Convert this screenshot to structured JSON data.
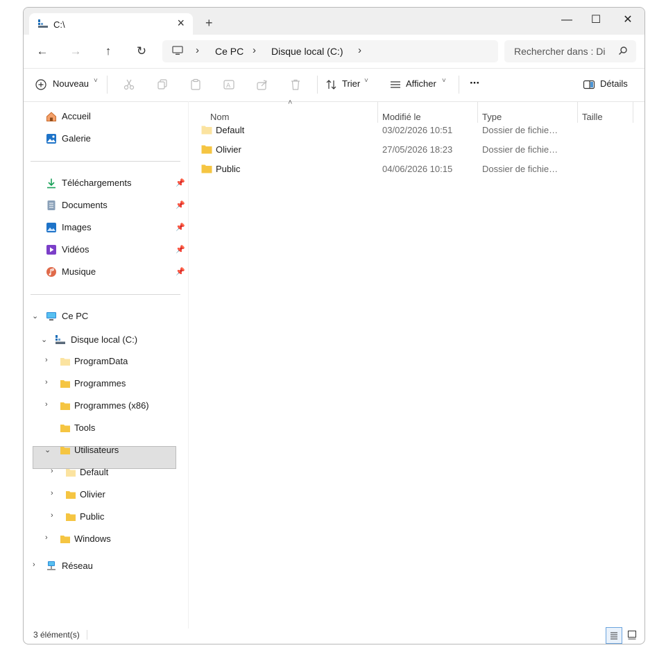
{
  "tab": {
    "title": "C:\\"
  },
  "window": {
    "minimize_glyph": "—",
    "maximize_glyph": "☐",
    "close_glyph": "✕"
  },
  "nav": {
    "back_glyph": "←",
    "forward_glyph": "→",
    "up_glyph": "↑",
    "refresh_glyph": "↻",
    "breadcrumbs": [
      "Ce PC",
      "Disque local (C:)"
    ],
    "chevron": "›",
    "search_placeholder": "Rechercher dans : Disque local (C:)"
  },
  "toolbar": {
    "new_label": "Nouveau",
    "sort_label": "Trier",
    "view_label": "Afficher",
    "more_glyph": "···",
    "details_label": "Détails",
    "dropdown_glyph": "˅"
  },
  "sidebar": {
    "quick": [
      {
        "label": "Accueil",
        "icon": "home-icon"
      },
      {
        "label": "Galerie",
        "icon": "gallery-icon"
      }
    ],
    "pinned": [
      {
        "label": "Téléchargements",
        "icon": "download-icon"
      },
      {
        "label": "Documents",
        "icon": "documents-icon"
      },
      {
        "label": "Images",
        "icon": "pictures-icon"
      },
      {
        "label": "Vidéos",
        "icon": "videos-icon"
      },
      {
        "label": "Musique",
        "icon": "music-icon"
      }
    ],
    "pin_glyph": "📌",
    "tree": {
      "this_pc": "Ce PC",
      "drive": "Disque local (C:)",
      "drive_children": [
        "ProgramData",
        "Programmes",
        "Programmes (x86)",
        "Tools",
        "Utilisateurs"
      ],
      "users_children": [
        "Default",
        "Olivier",
        "Public"
      ],
      "windows": "Windows",
      "network": "Réseau"
    }
  },
  "columns": {
    "name": "Nom",
    "modified": "Modifié le",
    "type": "Type",
    "size": "Taille"
  },
  "files": [
    {
      "name": "Default",
      "modified": "03/02/2026 10:51",
      "type": "Dossier de fichie…"
    },
    {
      "name": "Olivier",
      "modified": "27/05/2026 18:23",
      "type": "Dossier de fichie…"
    },
    {
      "name": "Public",
      "modified": "04/06/2026 10:15",
      "type": "Dossier de fichie…"
    }
  ],
  "status": {
    "count": "3 élément(s)"
  },
  "colors": {
    "folder": "#f5c542",
    "folder_light": "#fbe3a0",
    "accent": "#0067c0"
  }
}
